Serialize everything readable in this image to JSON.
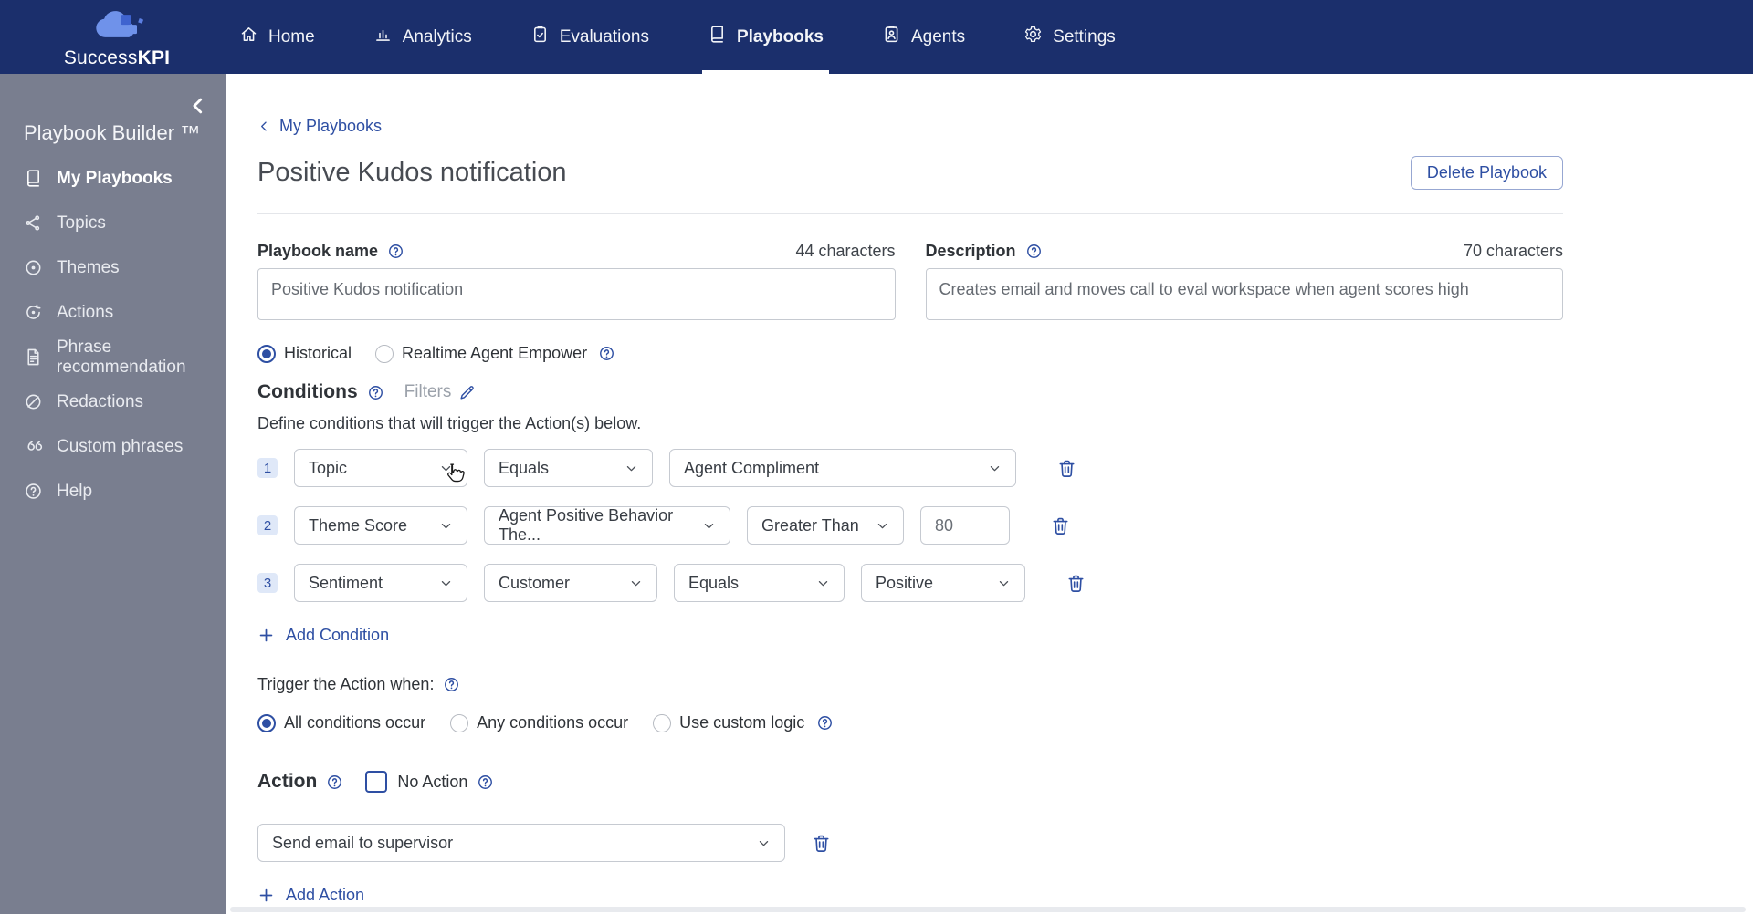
{
  "brand": {
    "name_regular": "Success",
    "name_bold": "KPI"
  },
  "colors": {
    "nav_bg": "#1b2f6c",
    "sidebar_bg": "#797e8f",
    "accent_blue": "#2e4fa3",
    "badge_bg": "#dfe8f8"
  },
  "topnav": {
    "items": [
      {
        "label": "Home",
        "icon": "home-icon",
        "active": false
      },
      {
        "label": "Analytics",
        "icon": "analytics-icon",
        "active": false
      },
      {
        "label": "Evaluations",
        "icon": "evaluations-icon",
        "active": false
      },
      {
        "label": "Playbooks",
        "icon": "playbooks-icon",
        "active": true
      },
      {
        "label": "Agents",
        "icon": "agents-icon",
        "active": false
      },
      {
        "label": "Settings",
        "icon": "settings-icon",
        "active": false
      }
    ]
  },
  "sidebar": {
    "title": "Playbook Builder ™",
    "items": [
      {
        "label": "My Playbooks",
        "icon": "book-icon",
        "active": true
      },
      {
        "label": "Topics",
        "icon": "topics-icon",
        "active": false
      },
      {
        "label": "Themes",
        "icon": "themes-icon",
        "active": false
      },
      {
        "label": "Actions",
        "icon": "actions-icon",
        "active": false
      },
      {
        "label": "Phrase recommendation",
        "icon": "phrase-icon",
        "active": false
      },
      {
        "label": "Redactions",
        "icon": "redactions-icon",
        "active": false
      },
      {
        "label": "Custom phrases",
        "icon": "quotes-icon",
        "active": false
      },
      {
        "label": "Help",
        "icon": "question-icon",
        "active": false
      }
    ]
  },
  "page": {
    "breadcrumb": "My Playbooks",
    "title": "Positive Kudos notification",
    "delete_button": "Delete Playbook",
    "name_field": {
      "label": "Playbook name",
      "counter": "44 characters",
      "value": "Positive Kudos notification"
    },
    "description_field": {
      "label": "Description",
      "counter": "70 characters",
      "value": "Creates email and moves call to eval workspace when agent scores high"
    },
    "mode_radios": [
      {
        "label": "Historical",
        "selected": true,
        "help": false
      },
      {
        "label": "Realtime Agent Empower",
        "selected": false,
        "help": true
      }
    ],
    "conditions": {
      "heading": "Conditions",
      "filters_label": "Filters",
      "subtext": "Define conditions that will trigger the Action(s) below.",
      "rows": [
        {
          "num": "1",
          "fields": [
            {
              "type": "select",
              "value": "Topic"
            },
            {
              "type": "select",
              "value": "Equals"
            },
            {
              "type": "select",
              "value": "Agent Compliment"
            }
          ]
        },
        {
          "num": "2",
          "fields": [
            {
              "type": "select",
              "value": "Theme Score"
            },
            {
              "type": "select",
              "value": "Agent Positive Behavior The..."
            },
            {
              "type": "select",
              "value": "Greater Than"
            },
            {
              "type": "input",
              "value": "80"
            }
          ]
        },
        {
          "num": "3",
          "fields": [
            {
              "type": "select",
              "value": "Sentiment"
            },
            {
              "type": "select",
              "value": "Customer"
            },
            {
              "type": "select",
              "value": "Equals"
            },
            {
              "type": "select",
              "value": "Positive"
            }
          ]
        }
      ],
      "add_label": "Add Condition",
      "trigger_label": "Trigger the Action when:",
      "trigger_radios": [
        {
          "label": "All conditions occur",
          "selected": true,
          "help": false
        },
        {
          "label": "Any conditions occur",
          "selected": false,
          "help": false
        },
        {
          "label": "Use custom logic",
          "selected": false,
          "help": true
        }
      ]
    },
    "action": {
      "heading": "Action",
      "no_action_label": "No Action",
      "rows": [
        {
          "value": "Send email to supervisor"
        }
      ],
      "add_label": "Add Action"
    }
  }
}
